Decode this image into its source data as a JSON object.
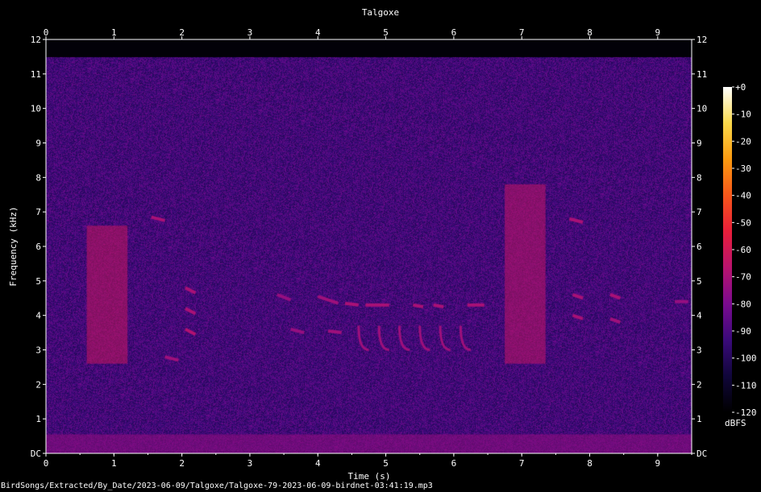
{
  "footer": {
    "source_path": "BirdSongs/Extracted/By_Date/2023-06-09/Talgoxe/Talgoxe-79-2023-06-09-birdnet-03:41:19.mp3"
  },
  "chart_data": {
    "type": "heatmap",
    "title": "Talgoxe",
    "xlabel": "Time (s)",
    "ylabel": "Frequency (kHz)",
    "xlim": [
      0,
      9.5
    ],
    "ylim": [
      0,
      12
    ],
    "x_ticks": [
      "0",
      "1",
      "2",
      "3",
      "4",
      "5",
      "6",
      "7",
      "8",
      "9"
    ],
    "y_ticks": [
      "DC",
      "1",
      "2",
      "3",
      "4",
      "5",
      "6",
      "7",
      "8",
      "9",
      "10",
      "11",
      "12"
    ],
    "colorbar": {
      "unit": "dBFS",
      "range": [
        -120,
        0
      ],
      "ticks": [
        "+0",
        "-10",
        "-20",
        "-30",
        "-40",
        "-50",
        "-60",
        "-70",
        "-80",
        "-90",
        "-100",
        "-110",
        "-120"
      ],
      "colors": [
        "#000000",
        "#10063a",
        "#3a0a7a",
        "#7a0b8f",
        "#b8136e",
        "#e81e3a",
        "#f6561a",
        "#fb9a10",
        "#f9d84a",
        "#ffffff"
      ]
    },
    "grid": false,
    "events": [
      {
        "kind": "broadband",
        "t0": 0.6,
        "t1": 1.2,
        "f0": 2.6,
        "f1": 6.6,
        "level": -62
      },
      {
        "kind": "broadband",
        "t0": 6.75,
        "t1": 7.35,
        "f0": 2.6,
        "f1": 7.8,
        "level": -64
      },
      {
        "kind": "tone",
        "t0": 1.55,
        "t1": 1.75,
        "f0": 6.85,
        "f1": 6.75,
        "level": -70
      },
      {
        "kind": "tone",
        "t0": 7.7,
        "t1": 7.9,
        "f0": 6.8,
        "f1": 6.7,
        "level": -70
      },
      {
        "kind": "tone",
        "t0": 2.05,
        "t1": 2.2,
        "f0": 3.6,
        "f1": 3.45,
        "level": -68
      },
      {
        "kind": "tone",
        "t0": 2.05,
        "t1": 2.2,
        "f0": 4.2,
        "f1": 4.05,
        "level": -70
      },
      {
        "kind": "tone",
        "t0": 2.05,
        "t1": 2.2,
        "f0": 4.8,
        "f1": 4.65,
        "level": -70
      },
      {
        "kind": "tone",
        "t0": 1.75,
        "t1": 1.95,
        "f0": 2.8,
        "f1": 2.7,
        "level": -72
      },
      {
        "kind": "tone",
        "t0": 3.4,
        "t1": 3.6,
        "f0": 4.6,
        "f1": 4.45,
        "level": -74
      },
      {
        "kind": "tone",
        "t0": 3.6,
        "t1": 3.8,
        "f0": 3.6,
        "f1": 3.5,
        "level": -74
      },
      {
        "kind": "tone",
        "t0": 4.0,
        "t1": 4.3,
        "f0": 4.55,
        "f1": 4.35,
        "level": -72
      },
      {
        "kind": "tone",
        "t0": 4.4,
        "t1": 4.6,
        "f0": 4.35,
        "f1": 4.3,
        "level": -70
      },
      {
        "kind": "tone",
        "t0": 4.7,
        "t1": 5.05,
        "f0": 4.3,
        "f1": 4.3,
        "level": -70
      },
      {
        "kind": "tone",
        "t0": 5.4,
        "t1": 5.55,
        "f0": 4.3,
        "f1": 4.25,
        "level": -70
      },
      {
        "kind": "tone",
        "t0": 5.7,
        "t1": 5.85,
        "f0": 4.3,
        "f1": 4.25,
        "level": -70
      },
      {
        "kind": "tone",
        "t0": 6.2,
        "t1": 6.45,
        "f0": 4.3,
        "f1": 4.3,
        "level": -70
      },
      {
        "kind": "tone",
        "t0": 4.15,
        "t1": 4.35,
        "f0": 3.55,
        "f1": 3.5,
        "level": -72
      },
      {
        "kind": "tone",
        "t0": 7.75,
        "t1": 7.9,
        "f0": 4.0,
        "f1": 3.9,
        "level": -70
      },
      {
        "kind": "tone",
        "t0": 7.75,
        "t1": 7.9,
        "f0": 4.6,
        "f1": 4.5,
        "level": -70
      },
      {
        "kind": "tone",
        "t0": 8.3,
        "t1": 8.45,
        "f0": 4.6,
        "f1": 4.5,
        "level": -70
      },
      {
        "kind": "tone",
        "t0": 8.3,
        "t1": 8.45,
        "f0": 3.9,
        "f1": 3.8,
        "level": -72
      },
      {
        "kind": "tone",
        "t0": 9.25,
        "t1": 9.45,
        "f0": 4.4,
        "f1": 4.4,
        "level": -74
      },
      {
        "kind": "sweep",
        "t0": 4.6,
        "t1": 4.75,
        "f0": 3.7,
        "f1": 3.0,
        "level": -72
      },
      {
        "kind": "sweep",
        "t0": 4.9,
        "t1": 5.05,
        "f0": 3.7,
        "f1": 3.0,
        "level": -72
      },
      {
        "kind": "sweep",
        "t0": 5.2,
        "t1": 5.35,
        "f0": 3.7,
        "f1": 3.0,
        "level": -72
      },
      {
        "kind": "sweep",
        "t0": 5.5,
        "t1": 5.65,
        "f0": 3.7,
        "f1": 3.0,
        "level": -72
      },
      {
        "kind": "sweep",
        "t0": 5.8,
        "t1": 5.95,
        "f0": 3.7,
        "f1": 3.0,
        "level": -72
      },
      {
        "kind": "sweep",
        "t0": 6.1,
        "t1": 6.25,
        "f0": 3.7,
        "f1": 3.0,
        "level": -72
      },
      {
        "kind": "low_band",
        "t0": 0.0,
        "t1": 9.5,
        "f0": 0.0,
        "f1": 0.55,
        "level": -74
      }
    ]
  }
}
